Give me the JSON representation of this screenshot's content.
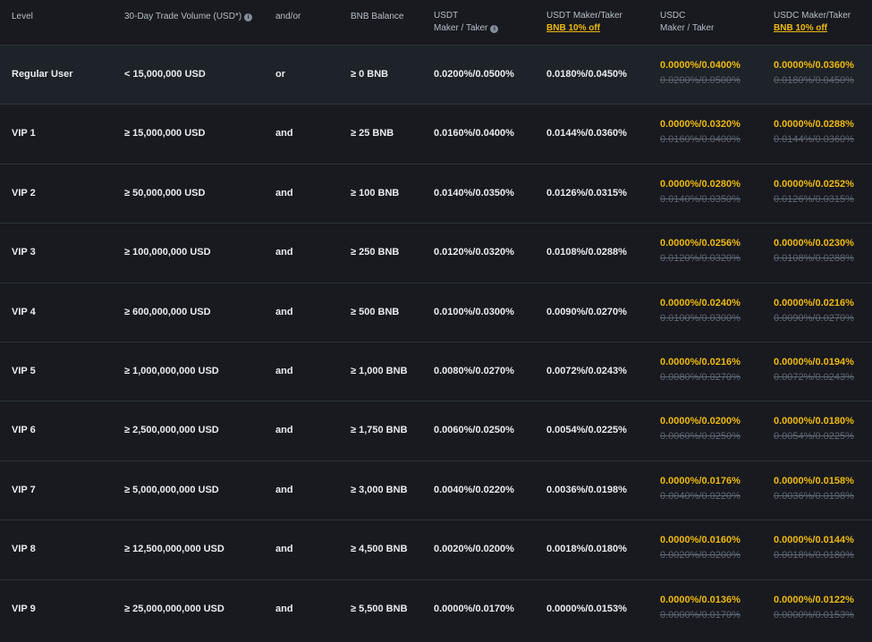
{
  "header": {
    "level": "Level",
    "volume": "30-Day Trade Volume (USD*)",
    "andor": "and/or",
    "bnb_balance": "BNB Balance",
    "usdt_line1": "USDT",
    "usdt_line2": "Maker / Taker",
    "usdt_disc_line1": "USDT Maker/Taker",
    "usdt_disc_sub": "BNB 10% off",
    "usdc_line1": "USDC",
    "usdc_line2": "Maker / Taker",
    "usdc_disc_line1": "USDC Maker/Taker",
    "usdc_disc_sub": "BNB 10% off"
  },
  "rows": [
    {
      "level": "Regular User",
      "volume": "< 15,000,000 USD",
      "andor": "or",
      "bnb": "≥ 0 BNB",
      "usdt": "0.0200%/0.0500%",
      "usdt_disc": "0.0180%/0.0450%",
      "usdc_new": "0.0000%/0.0400%",
      "usdc_old": "0.0200%/0.0500%",
      "usdc_disc_new": "0.0000%/0.0360%",
      "usdc_disc_old": "0.0180%/0.0450%"
    },
    {
      "level": "VIP 1",
      "volume": "≥ 15,000,000 USD",
      "andor": "and",
      "bnb": "≥ 25 BNB",
      "usdt": "0.0160%/0.0400%",
      "usdt_disc": "0.0144%/0.0360%",
      "usdc_new": "0.0000%/0.0320%",
      "usdc_old": "0.0160%/0.0400%",
      "usdc_disc_new": "0.0000%/0.0288%",
      "usdc_disc_old": "0.0144%/0.0360%"
    },
    {
      "level": "VIP 2",
      "volume": "≥ 50,000,000 USD",
      "andor": "and",
      "bnb": "≥ 100 BNB",
      "usdt": "0.0140%/0.0350%",
      "usdt_disc": "0.0126%/0.0315%",
      "usdc_new": "0.0000%/0.0280%",
      "usdc_old": "0.0140%/0.0350%",
      "usdc_disc_new": "0.0000%/0.0252%",
      "usdc_disc_old": "0.0126%/0.0315%"
    },
    {
      "level": "VIP 3",
      "volume": "≥ 100,000,000 USD",
      "andor": "and",
      "bnb": "≥ 250 BNB",
      "usdt": "0.0120%/0.0320%",
      "usdt_disc": "0.0108%/0.0288%",
      "usdc_new": "0.0000%/0.0256%",
      "usdc_old": "0.0120%/0.0320%",
      "usdc_disc_new": "0.0000%/0.0230%",
      "usdc_disc_old": "0.0108%/0.0288%"
    },
    {
      "level": "VIP 4",
      "volume": "≥ 600,000,000 USD",
      "andor": "and",
      "bnb": "≥ 500 BNB",
      "usdt": "0.0100%/0.0300%",
      "usdt_disc": "0.0090%/0.0270%",
      "usdc_new": "0.0000%/0.0240%",
      "usdc_old": "0.0100%/0.0300%",
      "usdc_disc_new": "0.0000%/0.0216%",
      "usdc_disc_old": "0.0090%/0.0270%"
    },
    {
      "level": "VIP 5",
      "volume": "≥ 1,000,000,000 USD",
      "andor": "and",
      "bnb": "≥ 1,000 BNB",
      "usdt": "0.0080%/0.0270%",
      "usdt_disc": "0.0072%/0.0243%",
      "usdc_new": "0.0000%/0.0216%",
      "usdc_old": "0.0080%/0.0270%",
      "usdc_disc_new": "0.0000%/0.0194%",
      "usdc_disc_old": "0.0072%/0.0243%"
    },
    {
      "level": "VIP 6",
      "volume": "≥ 2,500,000,000 USD",
      "andor": "and",
      "bnb": "≥ 1,750 BNB",
      "usdt": "0.0060%/0.0250%",
      "usdt_disc": "0.0054%/0.0225%",
      "usdc_new": "0.0000%/0.0200%",
      "usdc_old": "0.0060%/0.0250%",
      "usdc_disc_new": "0.0000%/0.0180%",
      "usdc_disc_old": "0.0054%/0.0225%"
    },
    {
      "level": "VIP 7",
      "volume": "≥ 5,000,000,000 USD",
      "andor": "and",
      "bnb": "≥ 3,000 BNB",
      "usdt": "0.0040%/0.0220%",
      "usdt_disc": "0.0036%/0.0198%",
      "usdc_new": "0.0000%/0.0176%",
      "usdc_old": "0.0040%/0.0220%",
      "usdc_disc_new": "0.0000%/0.0158%",
      "usdc_disc_old": "0.0036%/0.0198%"
    },
    {
      "level": "VIP 8",
      "volume": "≥ 12,500,000,000 USD",
      "andor": "and",
      "bnb": "≥ 4,500 BNB",
      "usdt": "0.0020%/0.0200%",
      "usdt_disc": "0.0018%/0.0180%",
      "usdc_new": "0.0000%/0.0160%",
      "usdc_old": "0.0020%/0.0200%",
      "usdc_disc_new": "0.0000%/0.0144%",
      "usdc_disc_old": "0.0018%/0.0180%"
    },
    {
      "level": "VIP 9",
      "volume": "≥ 25,000,000,000 USD",
      "andor": "and",
      "bnb": "≥ 5,500 BNB",
      "usdt": "0.0000%/0.0170%",
      "usdt_disc": "0.0000%/0.0153%",
      "usdc_new": "0.0000%/0.0136%",
      "usdc_old": "0.0000%/0.0170%",
      "usdc_disc_new": "0.0000%/0.0122%",
      "usdc_disc_old": "0.0000%/0.0153%"
    }
  ],
  "colors": {
    "background": "#181a20",
    "first_row": "#1e2329",
    "divider": "#2b3139",
    "accent": "#f0b90b",
    "muted": "#5e6673"
  },
  "icons": [
    "info-icon"
  ]
}
